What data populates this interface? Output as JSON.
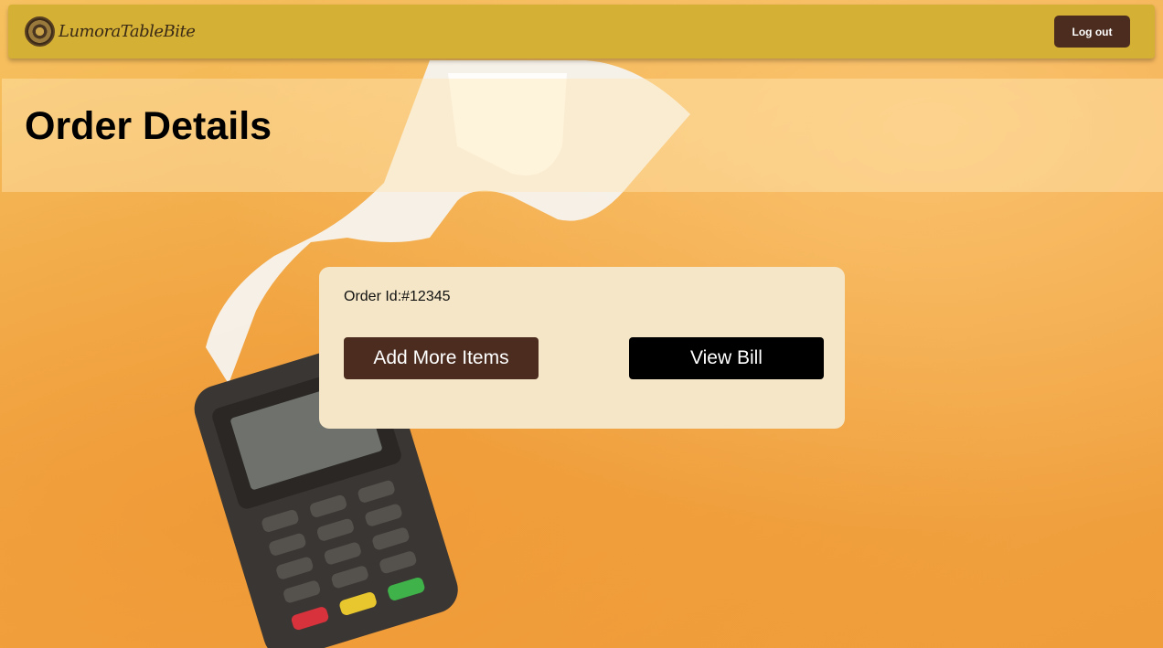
{
  "navbar": {
    "brand_name": "LumoraTableBite",
    "logout_label": "Log out"
  },
  "page": {
    "title": "Order Details"
  },
  "order": {
    "id_text": "Order Id:#12345",
    "add_items_label": "Add More Items",
    "view_bill_label": "View Bill"
  },
  "colors": {
    "navbar": "#d4b035",
    "primary_button": "#4b2c1f",
    "secondary_button": "#000000",
    "card": "#f4e6c6"
  }
}
